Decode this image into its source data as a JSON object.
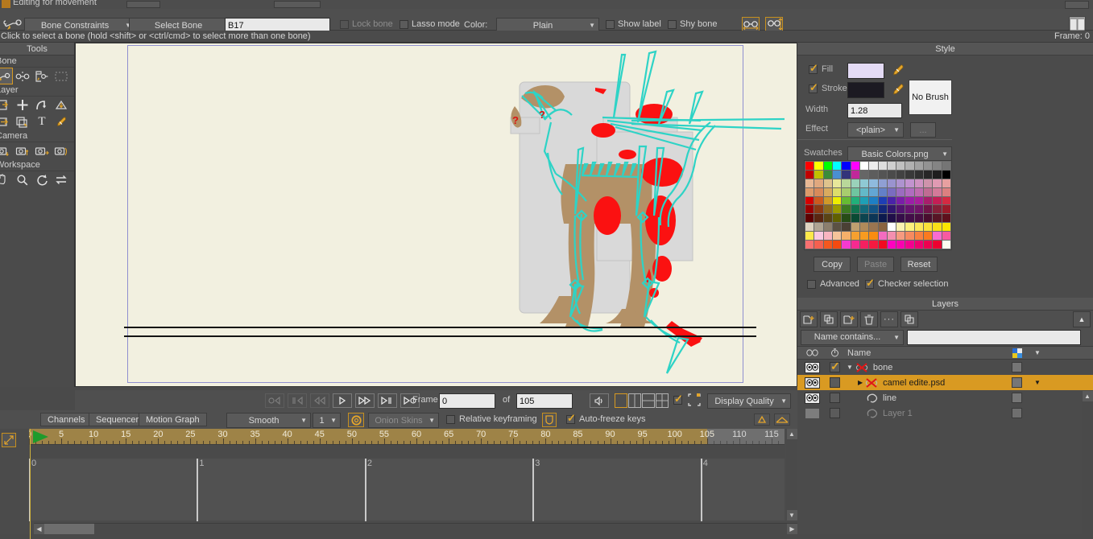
{
  "window": {
    "title": "Editing for movement"
  },
  "toolbar": {
    "bone_constraints": "Bone Constraints",
    "select_bone": "Select Bone",
    "bone_name_value": "B17",
    "lock_bone": "Lock bone",
    "lock_bone_checked": false,
    "lasso_mode": "Lasso mode",
    "lasso_mode_checked": false,
    "color_label": "Color:",
    "color_value": "Plain",
    "show_label": "Show label",
    "show_label_checked": false,
    "shy_bone": "Shy bone",
    "shy_bone_checked": false
  },
  "status": {
    "hint": "Click to select a bone (hold <shift> or <ctrl/cmd> to select more than one bone)",
    "frame": "Frame: 0"
  },
  "tools": {
    "title": "Tools",
    "groups": [
      {
        "label": "Bone",
        "icons": [
          "select-bone-icon",
          "bone-transform-icon",
          "bone-offset-icon",
          "bone-region-icon"
        ]
      },
      {
        "label": "Layer",
        "icons": [
          "transform-layer-icon",
          "add-point-icon",
          "curvature-icon",
          "shear-layer-icon",
          "rotate-layer-icon",
          "layer-copy-icon",
          "text-tool-icon",
          "eyedropper-icon"
        ]
      },
      {
        "label": "Camera",
        "icons": [
          "track-camera-icon",
          "zoom-camera-icon",
          "pan-camera-icon",
          "roll-camera-icon"
        ]
      },
      {
        "label": "Workspace",
        "icons": [
          "pan-hand-icon",
          "zoom-icon",
          "rotate-workspace-icon",
          "reset-workspace-icon"
        ]
      }
    ]
  },
  "playbar": {
    "buttons": [
      "rewind-to-start",
      "step-back-frame",
      "play-backward",
      "play",
      "fast-forward",
      "step-forward-frame",
      "go-to-end"
    ],
    "frame_label": "Frame",
    "frame_value": "0",
    "of_label": "of",
    "total_value": "105",
    "audio_icon": "speaker-icon",
    "view_layouts": [
      "single-view",
      "two-column-view",
      "two-row-view",
      "four-pane-view"
    ],
    "checkbox_checked": true,
    "bounds_icon": "select-bounds-icon",
    "display_quality": "Display Quality"
  },
  "style": {
    "title": "Style",
    "fill_label": "Fill",
    "fill_checked": true,
    "fill_color": "#e4dbf5",
    "stroke_label": "Stroke",
    "stroke_checked": true,
    "stroke_color": "#1c1a22",
    "width_label": "Width",
    "width_value": "1.28",
    "effect_label": "Effect",
    "effect_value": "<plain>",
    "effect_more": "...",
    "no_brush_label": "No Brush",
    "swatches_label": "Swatches",
    "swatches_file": "Basic Colors.png",
    "copy": "Copy",
    "paste": "Paste",
    "reset": "Reset",
    "advanced": "Advanced",
    "advanced_checked": false,
    "checker_selection": "Checker selection",
    "checker_checked": true,
    "swatch_colors": [
      "#fe0000",
      "#fefe00",
      "#00ff00",
      "#00ffff",
      "#0000ff",
      "#ff00ff",
      "#ffffff",
      "#ededed",
      "#dedede",
      "#cfcfcf",
      "#c0c0c0",
      "#b1b1b1",
      "#a2a2a2",
      "#939393",
      "#848484",
      "#757575",
      "#c00000",
      "#c0c000",
      "#3a8c3a",
      "#4a8fd2",
      "#33337a",
      "#c0289a",
      "#666666",
      "#5d5d5d",
      "#545454",
      "#4b4b4b",
      "#424242",
      "#393939",
      "#303030",
      "#272727",
      "#1e1e1e",
      "#000000",
      "#e8b894",
      "#e0a87f",
      "#dfc38d",
      "#e8e89a",
      "#b9d79a",
      "#9ad2ba",
      "#8fc9d4",
      "#8fbade",
      "#8f9fd4",
      "#9a93cf",
      "#ae93cf",
      "#c293cf",
      "#cf93c2",
      "#cf93ab",
      "#e09ab3",
      "#e8a0a0",
      "#dc9a6a",
      "#d88a5a",
      "#d9ab5f",
      "#dddd6a",
      "#a8cd6e",
      "#6fc5a0",
      "#63b9c8",
      "#63a6d4",
      "#6380c8",
      "#7a6cc0",
      "#9b6cc0",
      "#b06cc0",
      "#c06cb0",
      "#c06c93",
      "#d37a99",
      "#dc8080",
      "#d50000",
      "#cc5a1e",
      "#d09a2a",
      "#eded00",
      "#66bb33",
      "#21b07a",
      "#1e9fb5",
      "#1e7fc4",
      "#1e3fb5",
      "#4a23a8",
      "#7a1ea8",
      "#9c1ea8",
      "#a81e9c",
      "#a81e6b",
      "#c41e55",
      "#d52a42",
      "#9a0000",
      "#8c3a12",
      "#8c6a1e",
      "#9a9a00",
      "#3d7a22",
      "#11744f",
      "#13697a",
      "#135485",
      "#13287a",
      "#311670",
      "#521470",
      "#681470",
      "#701468",
      "#701447",
      "#852039",
      "#9a1a2a",
      "#5e0000",
      "#5a2610",
      "#5a4414",
      "#606000",
      "#274c16",
      "#0a4a33",
      "#0c444f",
      "#0c3656",
      "#0c1a4e",
      "#200e49",
      "#350d49",
      "#430d49",
      "#490d43",
      "#490d2e",
      "#571525",
      "#5e101c",
      "#ded3c0",
      "#b0a593",
      "#8c7f6d",
      "#5b5143",
      "#4a4034",
      "#c0a070",
      "#b08a5a",
      "#9a7550",
      "#8a6440",
      "#ffffff",
      "#fbf3b3",
      "#fdf07e",
      "#fce85a",
      "#fae23a",
      "#f9e018",
      "#fbe500",
      "#fde84a",
      "#f9c9e0",
      "#f9b5c0",
      "#f5c49a",
      "#f5b06a",
      "#f5a030",
      "#f79b20",
      "#f98c10",
      "#f46cc0",
      "#f48fb0",
      "#f79a80",
      "#f78a60",
      "#f98040",
      "#fb7a20",
      "#f96cd0",
      "#f75aa0",
      "#f87070",
      "#f46050",
      "#f4581e",
      "#f44a10",
      "#f63ad0",
      "#f62a90",
      "#f52060",
      "#f51a40",
      "#f10a20",
      "#ff00c0",
      "#fa00b0",
      "#f40090",
      "#f00070",
      "#ee0050",
      "#ec0030",
      "#fdfdf0"
    ]
  },
  "layers": {
    "title": "Layers",
    "toolbar_icons": [
      "new-layer-icon",
      "duplicate-layer-icon",
      "new-group-icon",
      "delete-layer-icon",
      "more-options-icon",
      "layer-settings-icon"
    ],
    "collapse_icon": "chevron-up-icon",
    "filter_mode": "Name contains...",
    "filter_value": "",
    "columns": {
      "visibility": "eye-icon",
      "lock": "timer-icon",
      "name": "Name",
      "color": "color-swatch-icon",
      "menu": "chevron-down-icon"
    },
    "rows": [
      {
        "name": "bone",
        "visible": true,
        "checked": true,
        "indent": 0,
        "expander": "down",
        "type_icon": "bone-layer-icon",
        "dimmed": false,
        "selected": false,
        "has_menu": false
      },
      {
        "name": "camel edite.psd",
        "visible": true,
        "checked": false,
        "indent": 1,
        "expander": "right",
        "type_icon": "bone-layer-icon",
        "dimmed": false,
        "selected": true,
        "has_menu": true
      },
      {
        "name": "line",
        "visible": true,
        "checked": false,
        "indent": 1,
        "expander": "none",
        "type_icon": "vector-layer-icon",
        "dimmed": false,
        "selected": false,
        "has_menu": false
      },
      {
        "name": "Layer 1",
        "visible": false,
        "checked": false,
        "indent": 1,
        "expander": "none",
        "type_icon": "vector-layer-icon",
        "dimmed": true,
        "selected": false,
        "has_menu": false
      }
    ]
  },
  "timeline": {
    "tabs": [
      "Channels",
      "Sequencer",
      "Motion Graph"
    ],
    "active_tab": "Channels",
    "interpolation": "Smooth",
    "interp_count": "1",
    "onion_icon": "onion-skin-icon",
    "onion_skins": "Onion Skins",
    "relative_keyframing": "Relative keyframing",
    "relative_checked": false,
    "shield_icon": "keyframe-shield-icon",
    "auto_freeze_keys": "Auto-freeze keys",
    "auto_freeze_checked": true,
    "right_icons": [
      "expand-up-icon",
      "collapse-icon"
    ],
    "ruler_start": 0,
    "ruler_end": 117,
    "ruler_labels": [
      0,
      5,
      10,
      15,
      20,
      25,
      30,
      35,
      40,
      45,
      50,
      55,
      60,
      65,
      70,
      75,
      80,
      85,
      90,
      95,
      100,
      105,
      110,
      115
    ],
    "ruler_active_end": 105,
    "playhead_frame": 0,
    "markers": [
      {
        "label": "0",
        "frame": 0
      },
      {
        "label": "1",
        "frame": 26
      },
      {
        "label": "2",
        "frame": 52
      },
      {
        "label": "3",
        "frame": 78
      },
      {
        "label": "4",
        "frame": 104
      }
    ]
  },
  "canvas": {
    "background": "#f2f0e0",
    "doc_border_color": "#8f8fcf",
    "bone_color": "#2ed3c6",
    "figure_color": "#b39167",
    "mark_color": "#fb1111",
    "object_color": "#d6d6d6"
  }
}
